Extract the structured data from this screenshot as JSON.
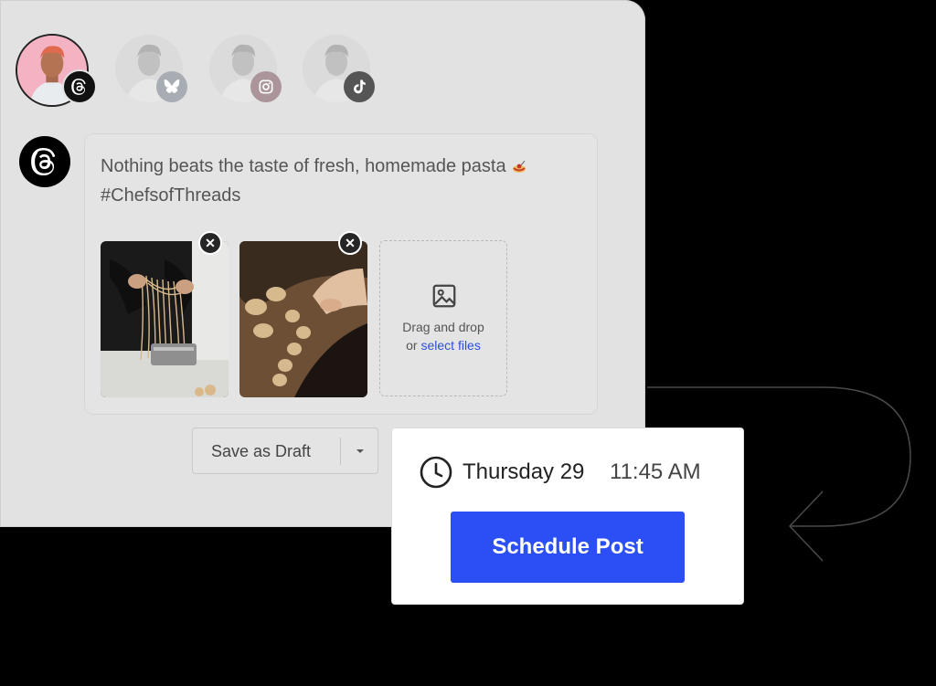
{
  "accounts": [
    {
      "platform": "threads",
      "badge_icon": "threads-icon",
      "active": true
    },
    {
      "platform": "bluesky",
      "badge_icon": "butterfly-icon",
      "active": false
    },
    {
      "platform": "instagram",
      "badge_icon": "instagram-icon",
      "active": false
    },
    {
      "platform": "tiktok",
      "badge_icon": "tiktok-icon",
      "active": false
    }
  ],
  "post": {
    "text_line1": "Nothing beats the taste of fresh, homemade pasta",
    "text_line2": "#ChefsofThreads",
    "emoji_icon": "spaghetti-icon"
  },
  "media": {
    "images": [
      {
        "name": "pasta-making-photo",
        "icon": "close-icon"
      },
      {
        "name": "dumplings-photo",
        "icon": "close-icon"
      }
    ],
    "dropzone": {
      "line1": "Drag and drop",
      "prefix": "or ",
      "link": "select files",
      "icon": "image-icon"
    }
  },
  "draft_button": {
    "label": "Save as Draft",
    "caret_icon": "caret-down-icon"
  },
  "schedule": {
    "date": "Thursday 29",
    "time": "11:45 AM",
    "button_label": "Schedule Post",
    "icon": "clock-icon"
  },
  "colors": {
    "accent": "#2b4ff5",
    "link": "#2b4fd9",
    "panel": "#e2e2e2",
    "background": "#000000"
  }
}
